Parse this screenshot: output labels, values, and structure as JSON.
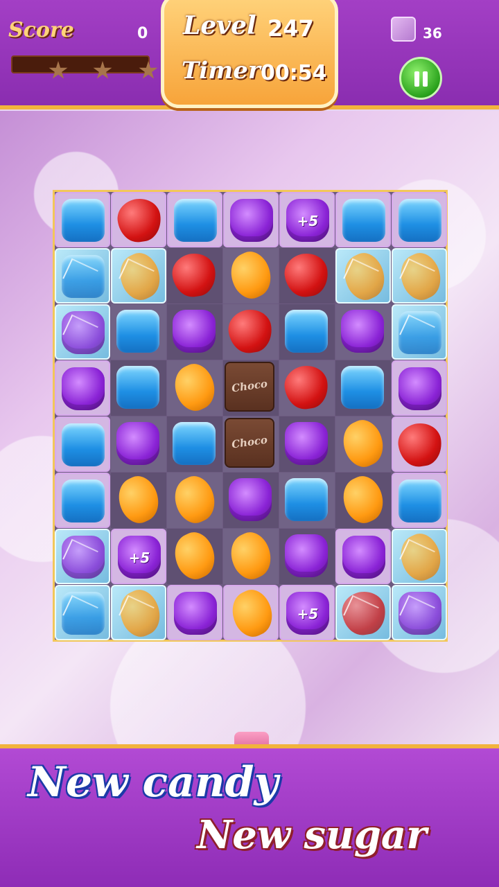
{
  "header": {
    "score_label": "Score",
    "score_value": "0",
    "level_label": "Level",
    "level_value": "247",
    "timer_label": "Timer",
    "timer_value": "00:54",
    "moves_value": "36",
    "stars_earned": 0,
    "stars_total": 3
  },
  "board": {
    "cols": 7,
    "rows": 8,
    "colors": {
      "blue": "#1e8fe4",
      "red": "#d31212",
      "purple": "#8a23d6",
      "orange": "#ff9a12",
      "choco": "#5a3120"
    },
    "cells": [
      [
        {
          "candy": "blue",
          "tile": "jelly"
        },
        {
          "candy": "red",
          "tile": "jelly"
        },
        {
          "candy": "blue",
          "tile": "jelly"
        },
        {
          "candy": "purple",
          "tile": "jelly"
        },
        {
          "candy": "purple",
          "tile": "jelly",
          "text": "+5"
        },
        {
          "candy": "blue",
          "tile": "jelly"
        },
        {
          "candy": "blue",
          "tile": "jelly"
        }
      ],
      [
        {
          "candy": "blue",
          "tile": "ice"
        },
        {
          "candy": "orange",
          "tile": "ice"
        },
        {
          "candy": "red",
          "tile": "dark"
        },
        {
          "candy": "orange",
          "tile": "light"
        },
        {
          "candy": "red",
          "tile": "dark"
        },
        {
          "candy": "orange",
          "tile": "ice"
        },
        {
          "candy": "orange",
          "tile": "ice"
        }
      ],
      [
        {
          "candy": "purple",
          "tile": "ice"
        },
        {
          "candy": "blue",
          "tile": "light"
        },
        {
          "candy": "purple",
          "tile": "dark"
        },
        {
          "candy": "red",
          "tile": "light"
        },
        {
          "candy": "blue",
          "tile": "dark"
        },
        {
          "candy": "purple",
          "tile": "light"
        },
        {
          "candy": "blue",
          "tile": "ice"
        }
      ],
      [
        {
          "candy": "purple",
          "tile": "jelly"
        },
        {
          "candy": "blue",
          "tile": "dark"
        },
        {
          "candy": "orange",
          "tile": "light"
        },
        {
          "candy": "choco",
          "tile": "dark",
          "text": "Choco"
        },
        {
          "candy": "red",
          "tile": "light"
        },
        {
          "candy": "blue",
          "tile": "dark"
        },
        {
          "candy": "purple",
          "tile": "jelly"
        }
      ],
      [
        {
          "candy": "blue",
          "tile": "jelly"
        },
        {
          "candy": "purple",
          "tile": "light"
        },
        {
          "candy": "blue",
          "tile": "dark"
        },
        {
          "candy": "choco",
          "tile": "light",
          "text": "Choco"
        },
        {
          "candy": "purple",
          "tile": "dark"
        },
        {
          "candy": "orange",
          "tile": "light"
        },
        {
          "candy": "red",
          "tile": "jelly"
        }
      ],
      [
        {
          "candy": "blue",
          "tile": "jelly"
        },
        {
          "candy": "orange",
          "tile": "dark"
        },
        {
          "candy": "orange",
          "tile": "light"
        },
        {
          "candy": "purple",
          "tile": "dark"
        },
        {
          "candy": "blue",
          "tile": "light"
        },
        {
          "candy": "orange",
          "tile": "dark"
        },
        {
          "candy": "blue",
          "tile": "jelly"
        }
      ],
      [
        {
          "candy": "purple",
          "tile": "ice"
        },
        {
          "candy": "purple",
          "tile": "jelly",
          "text": "+5"
        },
        {
          "candy": "orange",
          "tile": "dark"
        },
        {
          "candy": "orange",
          "tile": "light"
        },
        {
          "candy": "purple",
          "tile": "dark"
        },
        {
          "candy": "purple",
          "tile": "jelly"
        },
        {
          "candy": "orange",
          "tile": "ice"
        }
      ],
      [
        {
          "candy": "blue",
          "tile": "ice"
        },
        {
          "candy": "orange",
          "tile": "ice"
        },
        {
          "candy": "purple",
          "tile": "jelly"
        },
        {
          "candy": "orange",
          "tile": "jelly"
        },
        {
          "candy": "purple",
          "tile": "jelly",
          "text": "+5"
        },
        {
          "candy": "red",
          "tile": "ice"
        },
        {
          "candy": "purple",
          "tile": "ice"
        }
      ]
    ]
  },
  "footer": {
    "slogan_line1": "New candy",
    "slogan_line2": "New sugar"
  }
}
